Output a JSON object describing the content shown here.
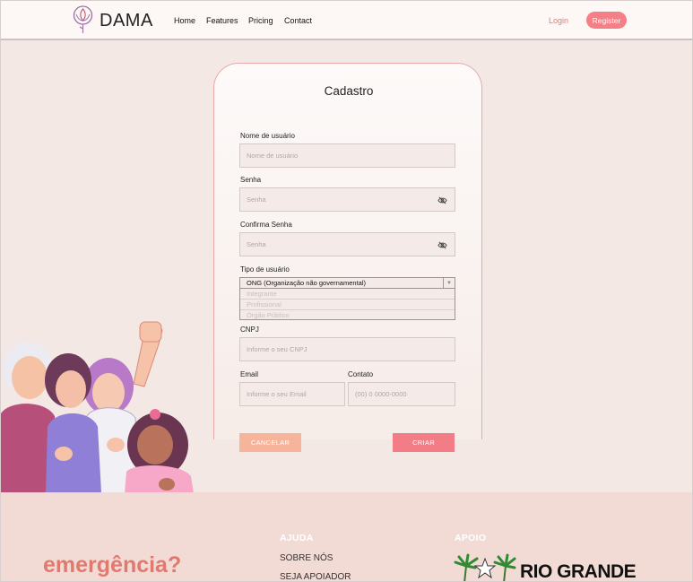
{
  "brand": {
    "name": "DAMA"
  },
  "nav": {
    "links": [
      "Home",
      "Features",
      "Pricing",
      "Contact"
    ],
    "login": "Login",
    "register": "Register"
  },
  "form": {
    "title": "Cadastro",
    "username": {
      "label": "Nome de usuário",
      "placeholder": "Nome de usuário"
    },
    "password": {
      "label": "Senha",
      "placeholder": "Senha"
    },
    "confirm": {
      "label": "Confirma Senha",
      "placeholder": "Senha"
    },
    "user_type": {
      "label": "Tipo de usuário",
      "selected": "ONG (Organização não governamental)",
      "options": [
        "Integrante",
        "Profissional",
        "Órgão Público"
      ]
    },
    "cnpj": {
      "label": "CNPJ",
      "placeholder": "Informe o seu CNPJ"
    },
    "email": {
      "label": "Email",
      "placeholder": "Informe o seu Email"
    },
    "contact": {
      "label": "Contato",
      "placeholder": "(00) 0 0000-0000"
    },
    "cancel": "CANCELAR",
    "create": "CRIAR"
  },
  "footer": {
    "emergency": "emergência?",
    "help_heading": "AJUDA",
    "help_links": [
      "SOBRE NÓS",
      "SEJA APOIADOR"
    ],
    "support_heading": "APOIO",
    "support_logo_text": "RIO GRANDE"
  },
  "colors": {
    "accent": "#f47f86",
    "background": "#f3e8e4",
    "card_border": "#e7a9a9",
    "footer_bg": "#f2dbd5",
    "cancel_button": "#f6b49a"
  }
}
